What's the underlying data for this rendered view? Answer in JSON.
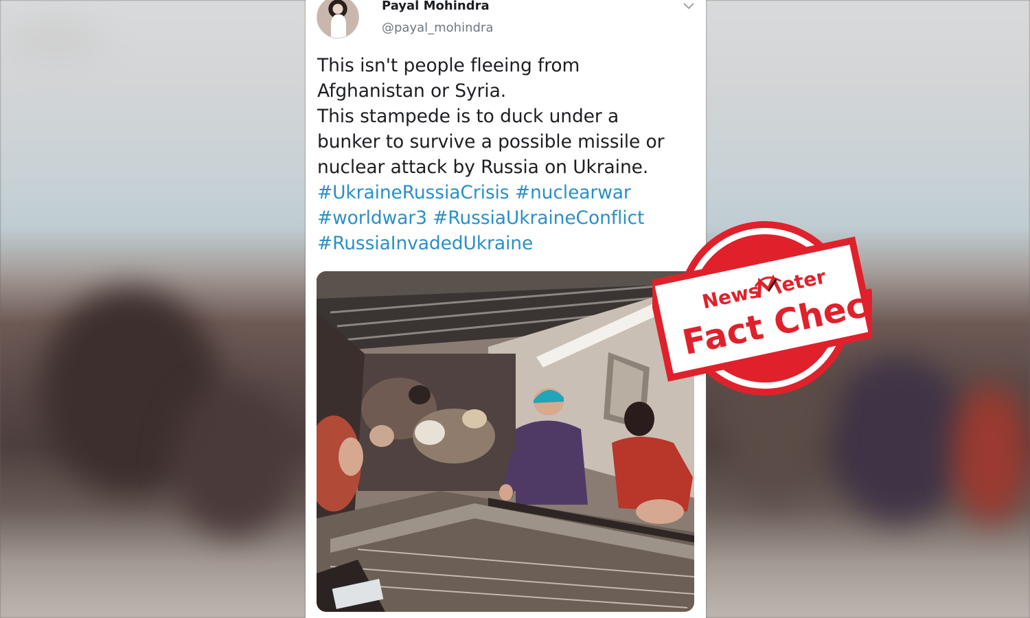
{
  "tweet": {
    "author_name": "Payal Mohindra",
    "author_handle": "@payal_mohindra",
    "text_lines": [
      "This isn't people fleeing from",
      "Afghanistan or Syria.",
      "This stampede is to duck under a",
      "bunker to survive a possible missile or",
      "nuclear attack by Russia on Ukraine."
    ],
    "hashtag_lines": [
      [
        "#UkraineRussiaCrisis",
        "#nuclearwar"
      ],
      [
        "#worldwar3",
        "#RussiaUkraineConflict"
      ],
      [
        "#RussiaInvadedUkraine"
      ]
    ],
    "menu_icon": "chevron-down-icon"
  },
  "stamp": {
    "brand_part1": "News",
    "brand_part2": "eter",
    "label": "Fact Check",
    "color": "#e0212b"
  },
  "colors": {
    "hashtag": "#2a8fc6",
    "text": "#1c1e21",
    "handle": "#6d7782"
  }
}
